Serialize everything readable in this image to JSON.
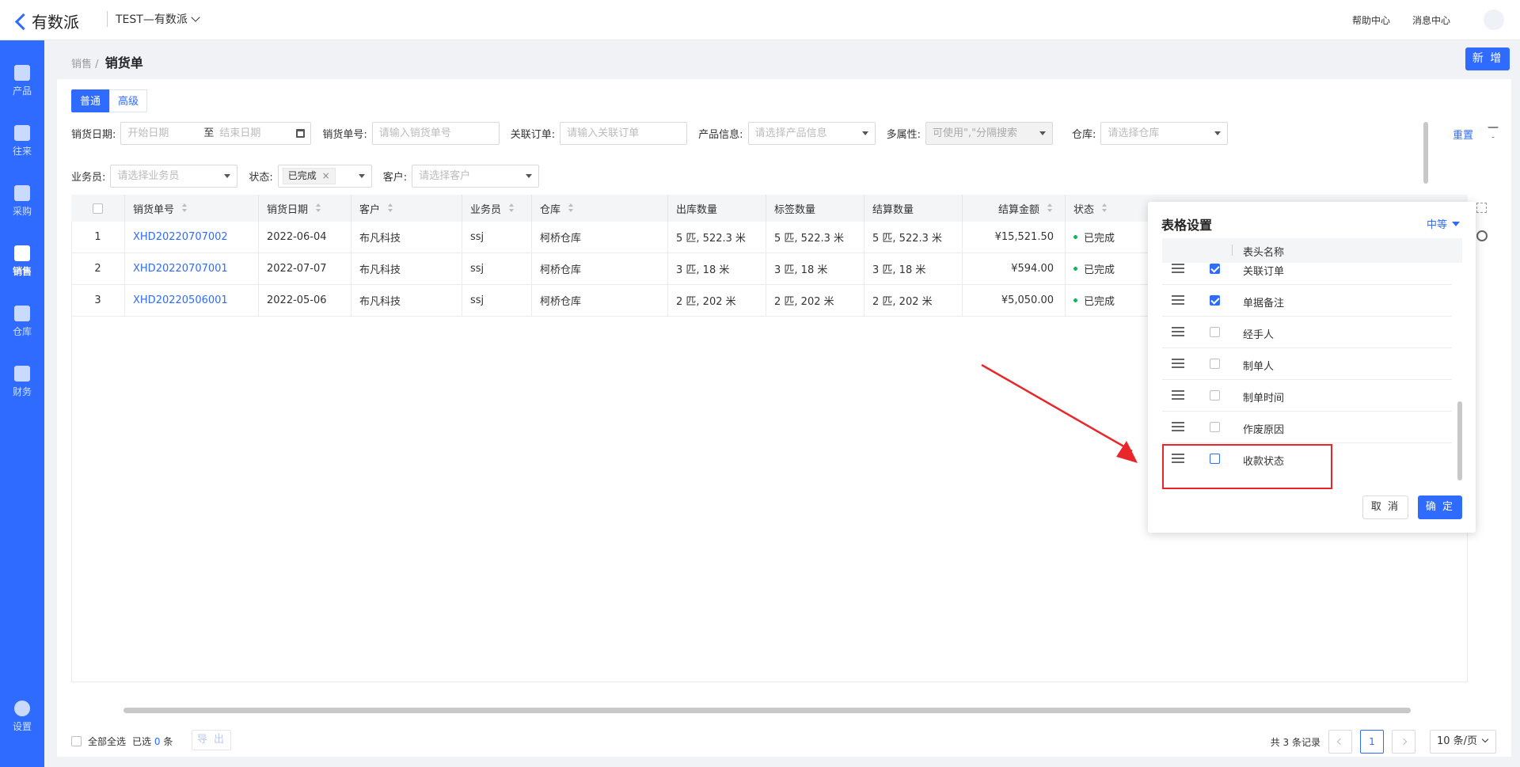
{
  "app": {
    "name": "有数派",
    "tenant": "TEST—有数派",
    "help": "帮助中心",
    "messages": "消息中心"
  },
  "sidebar": [
    {
      "label": "产品"
    },
    {
      "label": "往来"
    },
    {
      "label": "采购"
    },
    {
      "label": "销售",
      "active": true
    },
    {
      "label": "仓库"
    },
    {
      "label": "财务"
    },
    {
      "label": "设置"
    }
  ],
  "breadcrumb": {
    "parent": "销售",
    "sep": "/",
    "current": "销货单"
  },
  "new_button": "新 增",
  "modes": {
    "normal": "普通",
    "advanced": "高级"
  },
  "filters": {
    "date_label": "销货日期:",
    "date_start": "开始日期",
    "date_range_sep": "至",
    "date_end": "结束日期",
    "order_no_label": "销货单号:",
    "order_no_placeholder": "请输入销货单号",
    "related_label": "关联订单:",
    "related_placeholder": "请输入关联订单",
    "product_label": "产品信息:",
    "product_placeholder": "请选择产品信息",
    "attr_label": "多属性:",
    "attr_placeholder": "可使用\",\"分隔搜索",
    "warehouse_label": "仓库:",
    "warehouse_placeholder": "请选择仓库",
    "salesman_label": "业务员:",
    "salesman_placeholder": "请选择业务员",
    "status_label": "状态:",
    "status_tag": "已完成",
    "customer_label": "客户:",
    "customer_placeholder": "请选择客户",
    "reset": "重置"
  },
  "table": {
    "columns": [
      "销货单号",
      "销货日期",
      "客户",
      "业务员",
      "仓库",
      "出库数量",
      "标签数量",
      "结算数量",
      "结算金额",
      "状态"
    ],
    "rows": [
      {
        "idx": "1",
        "no": "XHD20220707002",
        "date": "2022-06-04",
        "customer": "布凡科技",
        "salesman": "ssj",
        "warehouse": "柯桥仓库",
        "out": "5 匹, 522.3 米",
        "tag": "5 匹, 522.3 米",
        "settle": "5 匹, 522.3 米",
        "amount": "¥15,521.50",
        "status": "已完成"
      },
      {
        "idx": "2",
        "no": "XHD20220707001",
        "date": "2022-07-07",
        "customer": "布凡科技",
        "salesman": "ssj",
        "warehouse": "柯桥仓库",
        "out": "3 匹, 18 米",
        "tag": "3 匹, 18 米",
        "settle": "3 匹, 18 米",
        "amount": "¥594.00",
        "status": "已完成"
      },
      {
        "idx": "3",
        "no": "XHD20220506001",
        "date": "2022-05-06",
        "customer": "布凡科技",
        "salesman": "ssj",
        "warehouse": "柯桥仓库",
        "out": "2 匹, 202 米",
        "tag": "2 匹, 202 米",
        "settle": "2 匹, 202 米",
        "amount": "¥5,050.00",
        "status": "已完成"
      }
    ]
  },
  "footer": {
    "select_all": "全部全选",
    "selected_prefix": "已选",
    "selected_count": "0",
    "selected_suffix": "条",
    "export": "导 出",
    "total": "共 3 条记录",
    "page": "1",
    "page_size": "10 条/页"
  },
  "table_settings": {
    "title": "表格设置",
    "size": "中等",
    "header_name": "表头名称",
    "items": [
      {
        "label": "关联订单",
        "checked": true
      },
      {
        "label": "单据备注",
        "checked": true
      },
      {
        "label": "经手人",
        "checked": false
      },
      {
        "label": "制单人",
        "checked": false
      },
      {
        "label": "制单时间",
        "checked": false
      },
      {
        "label": "作废原因",
        "checked": false
      },
      {
        "label": "收款状态",
        "checked": false
      }
    ],
    "cancel": "取 消",
    "ok": "确 定"
  },
  "colors": {
    "accent": "#2f6bff",
    "annotation": "#e8262b",
    "status_done": "#16b364"
  }
}
